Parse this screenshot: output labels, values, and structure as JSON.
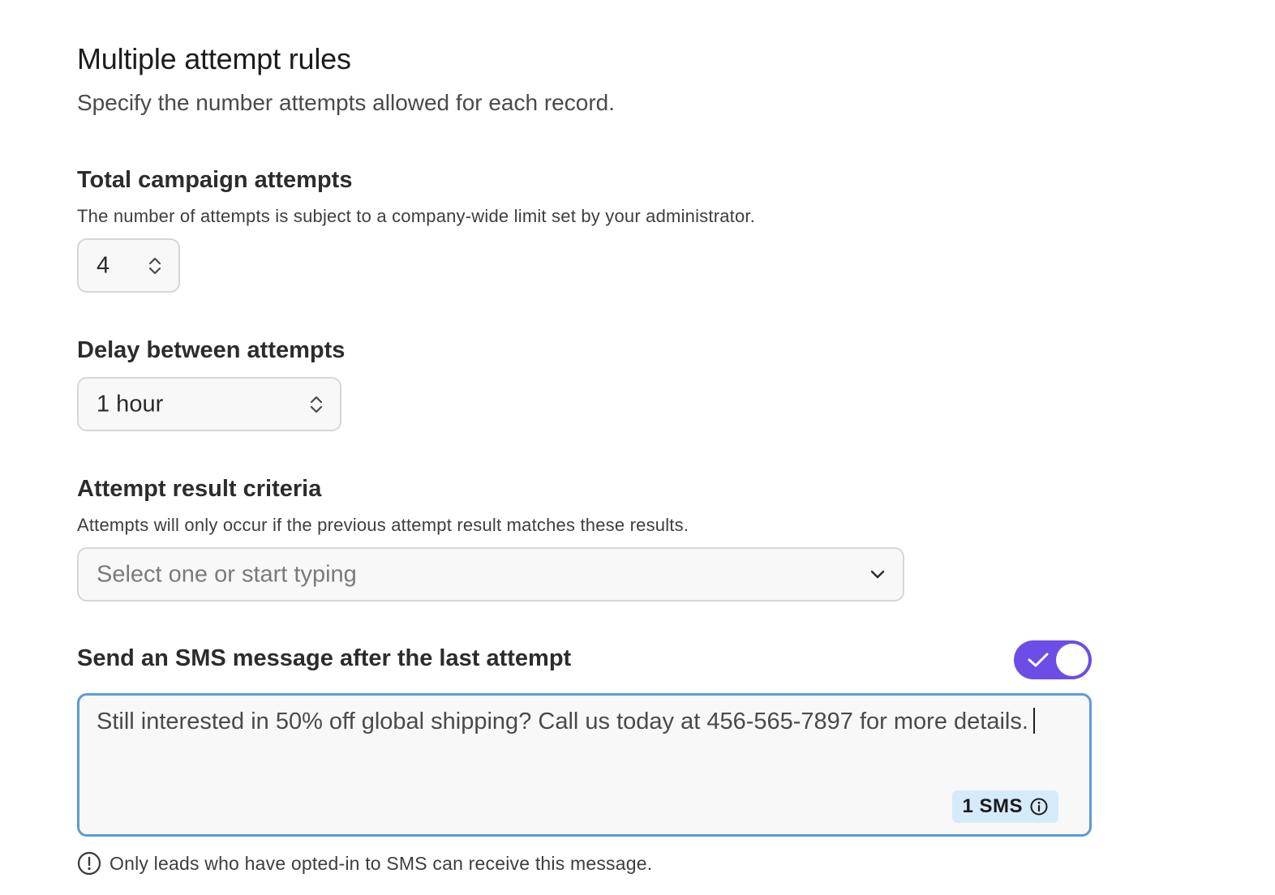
{
  "header": {
    "title": "Multiple attempt rules",
    "subtitle": "Specify the number attempts allowed for each record."
  },
  "total_attempts": {
    "heading": "Total campaign attempts",
    "description": "The number of attempts is subject to a company-wide limit set by your administrator.",
    "value": "4",
    "icon": "chevron-up-down-icon"
  },
  "delay": {
    "heading": "Delay between attempts",
    "selected": "1 hour",
    "icon": "chevron-up-down-icon"
  },
  "criteria": {
    "heading": "Attempt result criteria",
    "description": "Attempts will only occur if the previous attempt result matches these results.",
    "placeholder": "Select one or start typing",
    "icon": "chevron-down-icon"
  },
  "sms": {
    "heading": "Send an SMS message after the last attempt",
    "toggle_on": true,
    "message": "Still interested in 50% off global shipping? Call us today at 456-565-7897 for more details.",
    "badge_label": "1 SMS",
    "badge_icon": "info-icon",
    "note": "Only leads who have opted-in to SMS can receive this message.",
    "note_icon": "alert-circle-icon"
  },
  "colors": {
    "toggle_accent": "#6d4de6",
    "focus_border": "#5d9bd8",
    "badge_bg": "#d6ebfa"
  }
}
